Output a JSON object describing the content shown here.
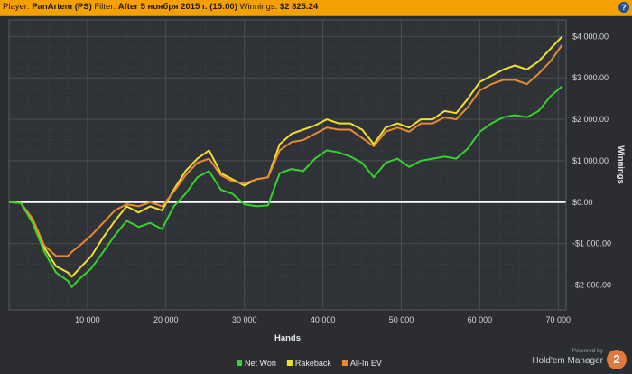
{
  "header": {
    "player_label": "Player:",
    "player_value": "PanArtem (PS)",
    "filter_label": "Filter:",
    "filter_value": "After 5 ноября 2015 г. (15:00)",
    "winnings_label": "Winnings:",
    "winnings_value": "$2 825.24",
    "help_glyph": "?"
  },
  "branding": {
    "powered": "Powered by",
    "name": "Hold'em Manager",
    "version": "2"
  },
  "colors": {
    "net_won": "#35d42a",
    "rakeback": "#f0e030",
    "allin_ev": "#e88a30",
    "zero_line": "#ffffff",
    "background": "#2b2d30",
    "accent": "#f3a000"
  },
  "chart_data": {
    "type": "line",
    "xlabel": "Hands",
    "ylabel": "Winnings",
    "xlim": [
      0,
      71000
    ],
    "ylim": [
      -2600,
      4400
    ],
    "x_ticks": [
      10000,
      20000,
      30000,
      40000,
      50000,
      60000,
      70000
    ],
    "x_tick_labels": [
      "10 000",
      "20 000",
      "30 000",
      "40 000",
      "50 000",
      "60 000",
      "70 000"
    ],
    "y_ticks": [
      -2000,
      -1000,
      0,
      1000,
      2000,
      3000,
      4000
    ],
    "y_tick_labels": [
      "-$2 000.00",
      "-$1 000.00",
      "$0.00",
      "$1 000.00",
      "$2 000.00",
      "$3 000.00",
      "$4 000.00"
    ],
    "legend_position": "bottom-center",
    "grid": true,
    "x": [
      0,
      1500,
      3000,
      4500,
      6000,
      7500,
      8000,
      9000,
      10500,
      12000,
      13500,
      15000,
      16500,
      18000,
      19500,
      21000,
      22500,
      24000,
      25500,
      27000,
      28500,
      30000,
      31500,
      33000,
      34500,
      36000,
      37500,
      39000,
      40500,
      42000,
      43500,
      45000,
      46500,
      48000,
      49500,
      51000,
      52500,
      54000,
      55500,
      57000,
      58500,
      60000,
      61500,
      63000,
      64500,
      66000,
      67500,
      69000,
      70500
    ],
    "series": [
      {
        "name": "Net Won",
        "values": [
          0,
          -20,
          -500,
          -1200,
          -1700,
          -1900,
          -2050,
          -1850,
          -1600,
          -1200,
          -800,
          -450,
          -600,
          -500,
          -650,
          -100,
          200,
          600,
          750,
          300,
          200,
          -50,
          -100,
          -80,
          700,
          800,
          750,
          1050,
          1250,
          1200,
          1100,
          950,
          600,
          950,
          1050,
          850,
          1000,
          1050,
          1100,
          1050,
          1300,
          1700,
          1900,
          2050,
          2100,
          2050,
          2200,
          2550,
          2800
        ]
      },
      {
        "name": "Rakeback",
        "values": [
          0,
          -20,
          -450,
          -1100,
          -1550,
          -1700,
          -1800,
          -1600,
          -1300,
          -850,
          -450,
          -100,
          -250,
          -100,
          -200,
          300,
          750,
          1050,
          1250,
          700,
          550,
          400,
          550,
          600,
          1400,
          1650,
          1750,
          1850,
          2000,
          1900,
          1900,
          1750,
          1400,
          1800,
          1900,
          1800,
          2000,
          2000,
          2200,
          2150,
          2500,
          2900,
          3050,
          3200,
          3300,
          3200,
          3400,
          3700,
          4000
        ]
      },
      {
        "name": "All-In EV",
        "values": [
          0,
          -20,
          -400,
          -1050,
          -1300,
          -1300,
          -1200,
          -1050,
          -800,
          -500,
          -200,
          -50,
          -100,
          0,
          -100,
          250,
          650,
          950,
          1050,
          650,
          500,
          450,
          550,
          600,
          1250,
          1450,
          1500,
          1650,
          1800,
          1750,
          1750,
          1550,
          1350,
          1700,
          1800,
          1700,
          1900,
          1900,
          2050,
          2000,
          2300,
          2700,
          2850,
          2950,
          2950,
          2850,
          3100,
          3400,
          3800
        ]
      }
    ]
  }
}
